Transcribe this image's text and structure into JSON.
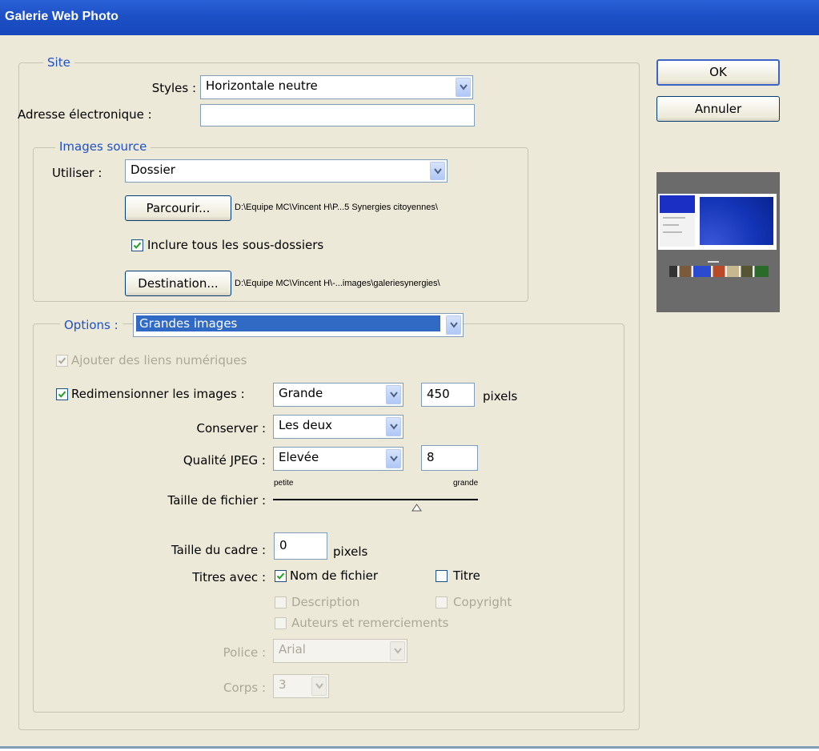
{
  "window": {
    "title": "Galerie Web Photo"
  },
  "site": {
    "legend": "Site",
    "styles_label": "Styles :",
    "styles_value": "Horizontale neutre",
    "email_label": "Adresse électronique :",
    "email_value": ""
  },
  "source": {
    "legend": "Images source",
    "use_label": "Utiliser :",
    "use_value": "Dossier",
    "browse_button": "Parcourir...",
    "browse_path": "D:\\Equipe MC\\Vincent H\\P...5 Synergies citoyennes\\",
    "include_subfolders": "Inclure tous les sous-dossiers",
    "destination_button": "Destination...",
    "destination_path": "D:\\Equipe MC\\Vincent H\\-...images\\galeriesynergies\\"
  },
  "options": {
    "legend": "Options :",
    "value": "Grandes images",
    "add_links": "Ajouter des liens numériques",
    "resize_label": "Redimensionner les images :",
    "resize_value": "Grande",
    "resize_pixels": "450",
    "pixels_unit": "pixels",
    "keep_label": "Conserver :",
    "keep_value": "Les deux",
    "jpeg_label": "Qualité JPEG :",
    "jpeg_value": "Elevée",
    "jpeg_number": "8",
    "filesize_label": "Taille de fichier :",
    "filesize_small": "petite",
    "filesize_large": "grande",
    "filesize_level": 0.7,
    "border_label": "Taille du cadre :",
    "border_value": "0",
    "border_unit": "pixels",
    "titles_label": "Titres avec :",
    "title_filename": "Nom de fichier",
    "title_title": "Titre",
    "title_description": "Description",
    "title_copyright": "Copyright",
    "title_credits": "Auteurs et remerciements",
    "font_label": "Police :",
    "font_value": "Arial",
    "size_label": "Corps :",
    "size_value": "3"
  },
  "buttons": {
    "ok": "OK",
    "cancel": "Annuler"
  },
  "colors": {
    "titlebar": "#1d50c6",
    "dialog": "#ece9d8",
    "legend_text": "#1e50c8",
    "selection": "#316ac5"
  }
}
